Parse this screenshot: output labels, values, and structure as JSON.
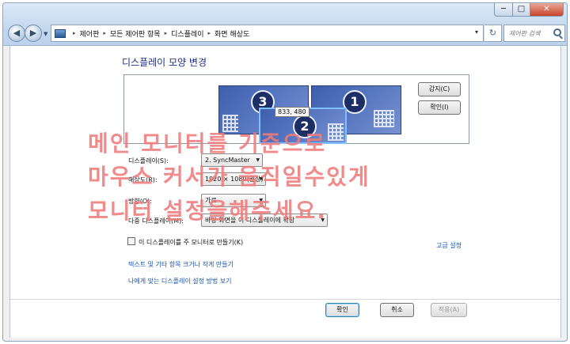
{
  "window": {
    "caption_min": "─",
    "caption_max": "□",
    "caption_close": "✕"
  },
  "nav": {
    "back_glyph": "◀",
    "forward_glyph": "▶",
    "dropdown_glyph": "▼"
  },
  "address": {
    "crumbs": [
      "제어판",
      "모든 제어판 항목",
      "디스플레이",
      "화면 해상도"
    ],
    "sep_glyph": "▸",
    "chevron_glyph": "▾",
    "refresh_glyph": "↻"
  },
  "search": {
    "placeholder": "제어판 검색"
  },
  "page": {
    "title": "디스플레이 모양 변경"
  },
  "preview": {
    "monitors": [
      {
        "id": "3",
        "label": "3"
      },
      {
        "id": "1",
        "label": "1"
      },
      {
        "id": "2",
        "label": "2"
      }
    ],
    "coords": "833, 480"
  },
  "buttons": {
    "detect": "감지(C)",
    "identify": "확인(I)",
    "ok": "확인",
    "cancel": "취소",
    "apply": "적용(A)"
  },
  "form": {
    "display_label": "디스플레이(S):",
    "display_value": "2. SyncMaster",
    "resolution_label": "해상도(R):",
    "resolution_value": "1920 × 1080(권장)",
    "orientation_label": "방향(O):",
    "orientation_value": "가로",
    "multi_label": "다중 디스플레이(M):",
    "multi_value": "바탕 화면을 이 디스플레이에 확장",
    "select_chev": "▼"
  },
  "main_display": {
    "label": "이 디스플레이를 주 모니터로 만들기(K)",
    "checked": false
  },
  "links": {
    "advanced": "고급 설정",
    "text_size": "텍스트 및 기타 항목 크거나 작게 만들기",
    "help": "나에게 맞는 디스플레이 설정 방법 보기"
  },
  "overlay_text": {
    "line1": "메인 모니터를 기준으로",
    "line2": "마우스 커서가 움직일수있게",
    "line3": "모니터 설정을해주세요."
  },
  "colors": {
    "link": "#1a55b3",
    "title": "#1e3287",
    "overlay": "#f07a7a",
    "monitor": "#4f6fba"
  }
}
